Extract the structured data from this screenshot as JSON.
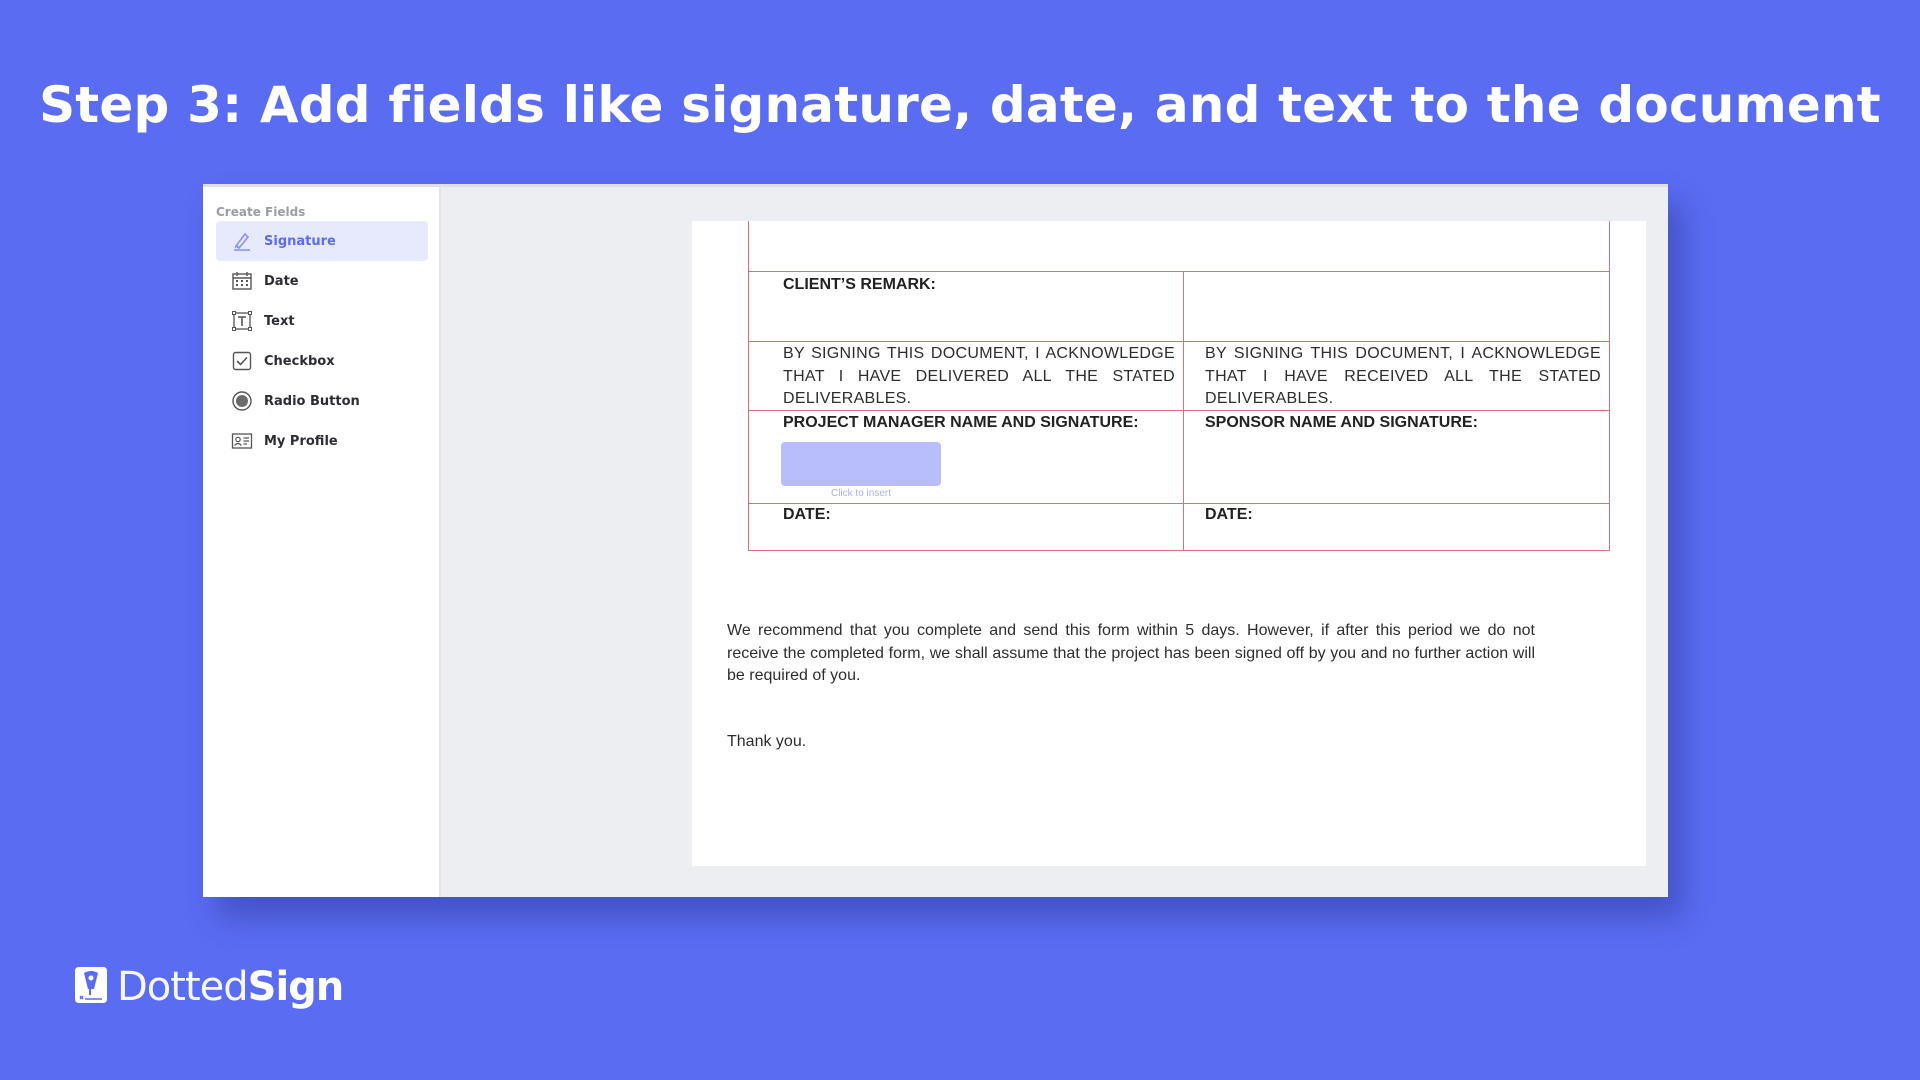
{
  "headline": "Step 3: Add fields like signature, date, and text to the document",
  "sidebar": {
    "heading": "Create Fields",
    "items": [
      {
        "label": "Signature",
        "icon": "signature-pen-icon"
      },
      {
        "label": "Date",
        "icon": "calendar-icon"
      },
      {
        "label": "Text",
        "icon": "text-box-icon"
      },
      {
        "label": "Checkbox",
        "icon": "checkbox-icon"
      },
      {
        "label": "Radio Button",
        "icon": "radio-button-icon"
      },
      {
        "label": "My Profile",
        "icon": "profile-card-icon"
      }
    ]
  },
  "document": {
    "client_remark": "CLIENT’S REMARK:",
    "ack_left": "BY SIGNING THIS DOCUMENT, I ACKNOWLEDGE THAT I HAVE DELIVERED ALL THE STATED DELIVERABLES.",
    "ack_right": "BY SIGNING THIS DOCUMENT, I ACKNOWLEDGE THAT I HAVE RECEIVED ALL THE STATED DELIVERABLES.",
    "pm_signature_label": "PROJECT MANAGER NAME AND SIGNATURE:",
    "sponsor_signature_label": "SPONSOR NAME AND SIGNATURE:",
    "signature_field_hint": "Click to insert",
    "date_left": "DATE:",
    "date_right": "DATE:",
    "paragraph": "We recommend that you complete and send this form within 5 days. However, if after this period we do not receive the completed form, we shall assume that the project has been signed off by you and no further action will be required of you.",
    "thanks": "Thank you."
  },
  "brand": {
    "name_part1": "Dotted",
    "name_part2": "Sign",
    "background_color": "#5a6cf2",
    "accent_color": "#b8befb"
  }
}
